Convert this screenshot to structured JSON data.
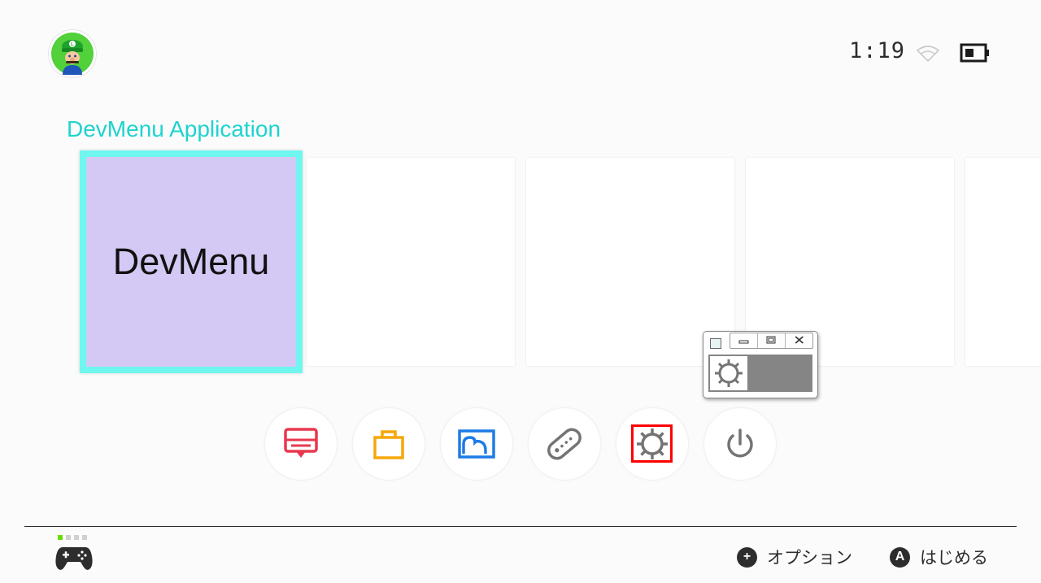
{
  "status": {
    "time": "1:19",
    "wifi_icon": "wifi-icon",
    "battery_icon": "battery-icon"
  },
  "user": {
    "avatar_icon": "luigi-avatar-icon"
  },
  "section": {
    "title": "DevMenu Application"
  },
  "tiles": [
    {
      "label": "DevMenu",
      "selected": true,
      "color": "#d4c9f4"
    },
    {
      "label": ""
    },
    {
      "label": ""
    },
    {
      "label": ""
    },
    {
      "label": ""
    }
  ],
  "dock": [
    {
      "icon": "news-icon",
      "color": "#e8384f"
    },
    {
      "icon": "eshop-bag-icon",
      "color": "#f5a70a"
    },
    {
      "icon": "album-icon",
      "color": "#1e7be6"
    },
    {
      "icon": "controllers-icon",
      "color": "#747474"
    },
    {
      "icon": "system-settings-gear-icon",
      "color": "#747474"
    },
    {
      "icon": "power-icon",
      "color": "#747474"
    }
  ],
  "footer": {
    "controller_icon": "pro-controller-icon",
    "options_glyph": "+",
    "options_label": "オプション",
    "start_glyph": "A",
    "start_label": "はじめる"
  },
  "colors": {
    "accent": "#1ed3cf",
    "selection_frame": "#6ef6ef",
    "focus_outline": "#ff0000"
  }
}
